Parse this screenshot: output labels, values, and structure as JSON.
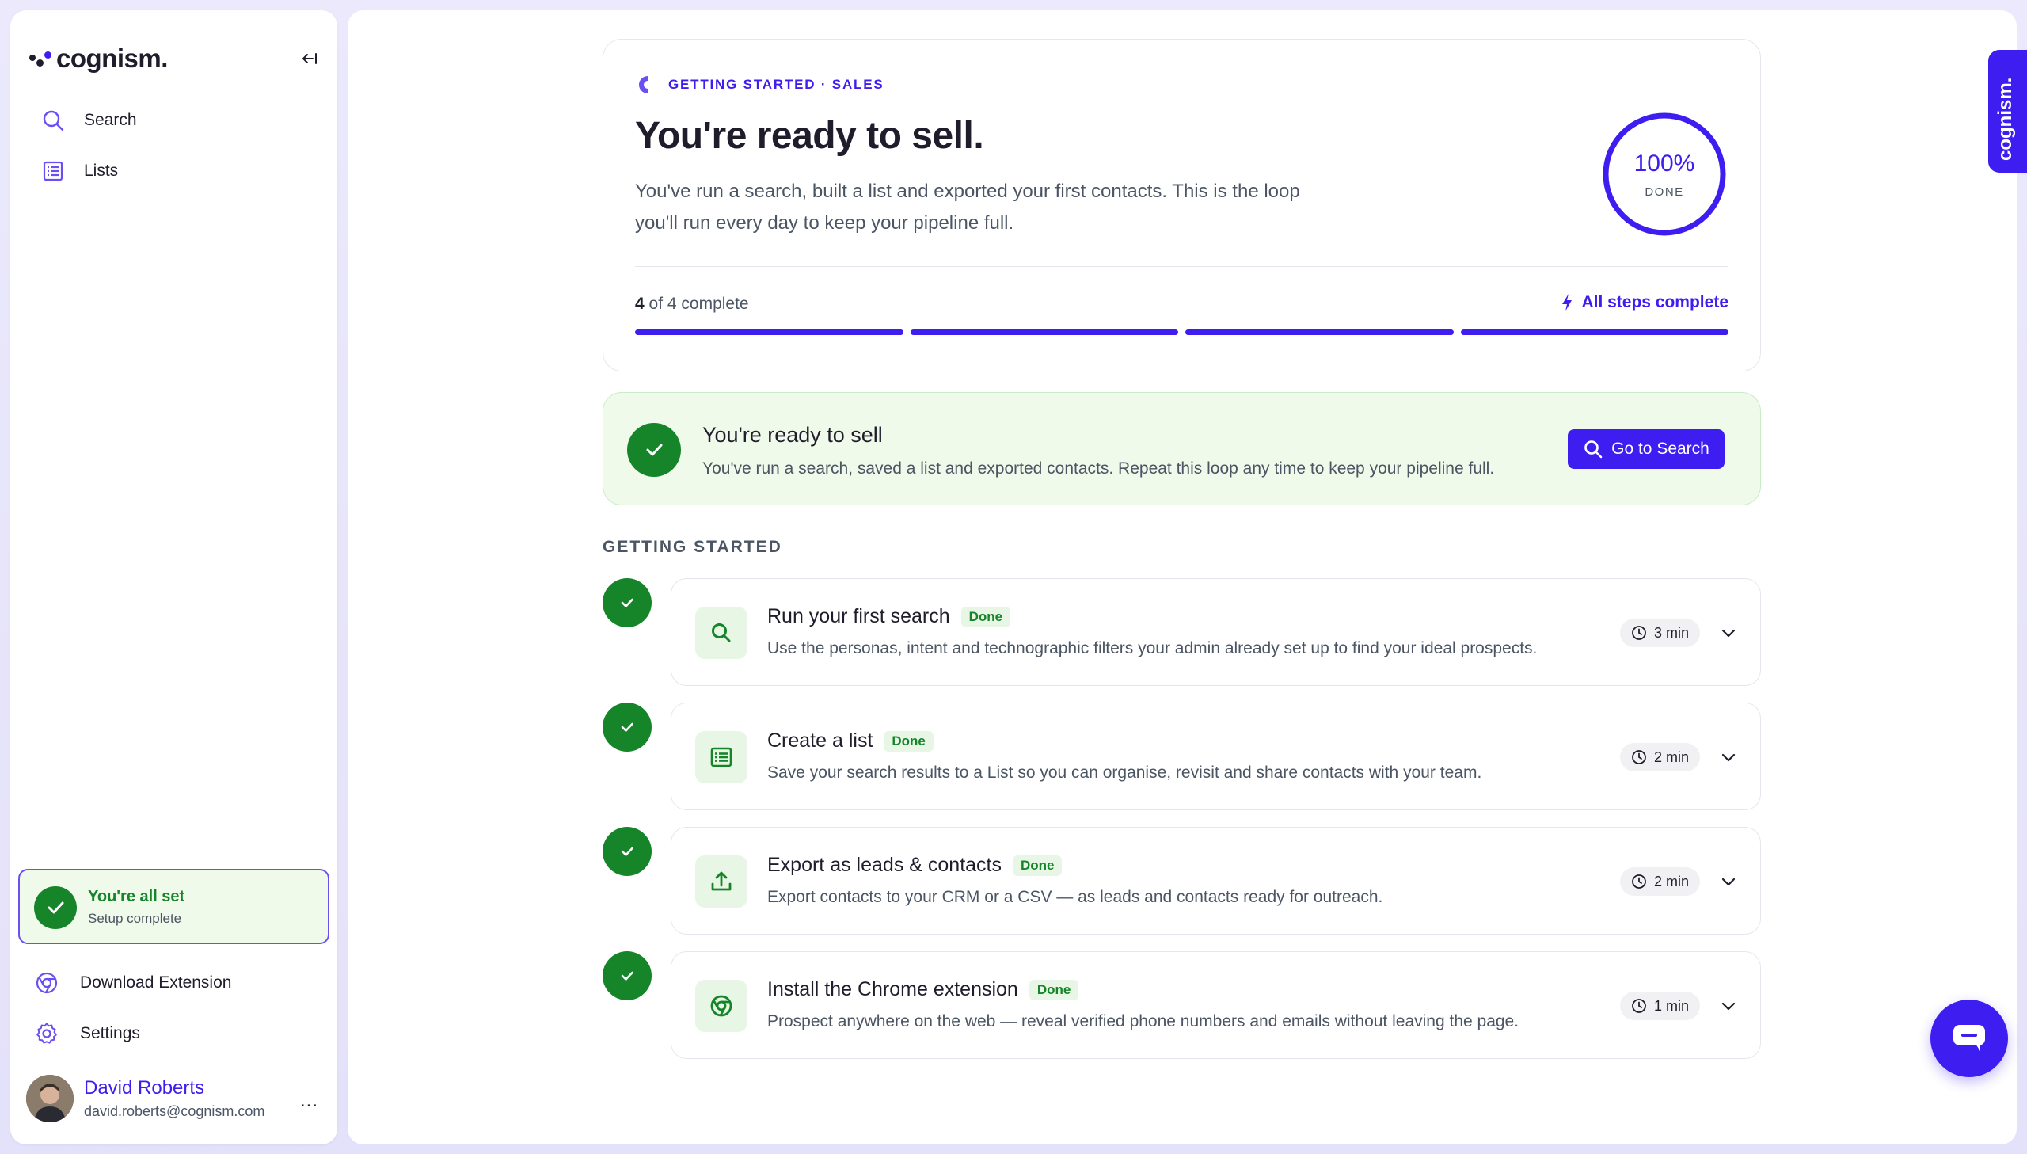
{
  "app": {
    "brand": "cognism."
  },
  "sidebar": {
    "nav": [
      {
        "label": "Search",
        "icon": "search-icon"
      },
      {
        "label": "Lists",
        "icon": "list-icon"
      }
    ],
    "setup": {
      "title": "You're all set",
      "subtitle": "Setup complete"
    },
    "links": [
      {
        "label": "Download Extension",
        "icon": "chrome-icon"
      },
      {
        "label": "Settings",
        "icon": "gear-icon"
      }
    ],
    "user": {
      "name": "David Roberts",
      "email": "david.roberts@cognism.com",
      "more": "..."
    }
  },
  "hero": {
    "eyebrow": "GETTING STARTED · SALES",
    "title": "You're ready to sell.",
    "description": "You've run a search, built a list and exported your first contacts. This is the loop you'll run every day to keep your pipeline full.",
    "ring": {
      "percent_label": "100%",
      "caption": "DONE",
      "progress": 1.0
    },
    "progress": {
      "completed": "4",
      "rest": "of 4 complete",
      "status": "All steps complete",
      "steps_total": 4,
      "steps_done": 4
    }
  },
  "banner": {
    "title": "You're ready to sell",
    "text": "You've run a search, saved a list and exported contacts. Repeat this loop any time to keep your pipeline full.",
    "button": "Go to Search"
  },
  "section_label": "GETTING STARTED",
  "steps": [
    {
      "title": "Run your first search",
      "badge": "Done",
      "description": "Use the personas, intent and technographic filters your admin already set up to find your ideal prospects.",
      "time": "3 min",
      "icon": "search-icon"
    },
    {
      "title": "Create a list",
      "badge": "Done",
      "description": "Save your search results to a List so you can organise, revisit and share contacts with your team.",
      "time": "2 min",
      "icon": "list-icon"
    },
    {
      "title": "Export as leads & contacts",
      "badge": "Done",
      "description": "Export contacts to your CRM or a CSV — as leads and contacts ready for outreach.",
      "time": "2 min",
      "icon": "upload-icon"
    },
    {
      "title": "Install the Chrome extension",
      "badge": "Done",
      "description": "Prospect anywhere on the web — reveal verified phone numbers and emails without leaving the page.",
      "time": "1 min",
      "icon": "chrome-icon"
    }
  ],
  "side_tab": {
    "label": "cognism."
  },
  "colors": {
    "accent": "#3d1df0",
    "success": "#16852a",
    "success_bg": "#effaea"
  }
}
